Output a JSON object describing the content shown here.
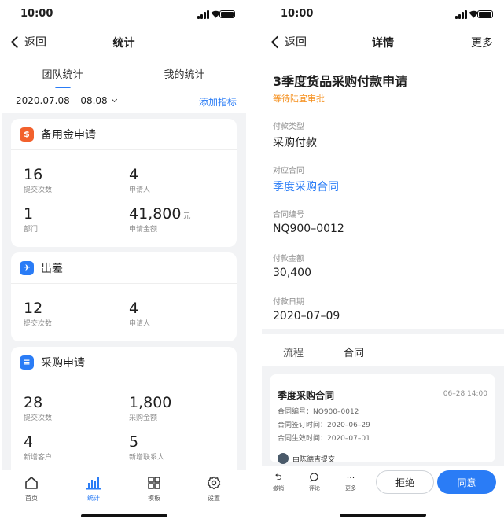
{
  "status": {
    "time": "10:00"
  },
  "left": {
    "nav": {
      "back": "返回",
      "title": "统计"
    },
    "tabs": [
      "团队统计",
      "我的统计"
    ],
    "filter": {
      "date_range": "2020.07.08 – 08.08",
      "add_metric": "添加指标"
    },
    "cards": [
      {
        "title": "备用金申请",
        "icon": "money-bag-icon",
        "color": "#f2612d",
        "stats": [
          {
            "value": "16",
            "label": "提交次数"
          },
          {
            "value": "4",
            "label": "申请人"
          },
          {
            "value": "1",
            "label": "部门"
          },
          {
            "value": "41,800",
            "unit": "元",
            "label": "申请金额"
          }
        ]
      },
      {
        "title": "出差",
        "icon": "plane-icon",
        "color": "#2a7cf6",
        "stats": [
          {
            "value": "12",
            "label": "提交次数"
          },
          {
            "value": "4",
            "label": "申请人"
          }
        ]
      },
      {
        "title": "采购申请",
        "icon": "document-icon",
        "color": "#2a7cf6",
        "stats": [
          {
            "value": "28",
            "label": "提交次数"
          },
          {
            "value": "1,800",
            "label": "采购金额"
          },
          {
            "value": "4",
            "label": "新增客户"
          },
          {
            "value": "5",
            "label": "新增联系人"
          }
        ]
      }
    ],
    "tabbar": [
      {
        "label": "首页",
        "icon": "home-icon"
      },
      {
        "label": "统计",
        "icon": "chart-icon"
      },
      {
        "label": "模板",
        "icon": "grid-icon"
      },
      {
        "label": "设置",
        "icon": "gear-icon"
      }
    ]
  },
  "right": {
    "nav": {
      "back": "返回",
      "title": "详情",
      "more": "更多"
    },
    "title": "3季度货品采购付款申请",
    "status": "等待陆宜审批",
    "fields": [
      {
        "label": "付款类型",
        "value": "采购付款"
      },
      {
        "label": "对应合同",
        "value": "季度采购合同"
      },
      {
        "label": "合同编号",
        "value": "NQ900–0012"
      },
      {
        "label": "付款金额",
        "value": "30,400"
      },
      {
        "label": "付款日期",
        "value": "2020–07–09"
      }
    ],
    "tabs": [
      "流程",
      "合同"
    ],
    "contract": {
      "title": "季度采购合同",
      "time": "06–28 14:00",
      "lines": [
        "合同编号：NQ900–0012",
        "合同签订时间：2020–06–29",
        "合同生效时间：2020–07–01"
      ],
      "submitter": "由陈德吉提交"
    },
    "actions": [
      {
        "label": "撤销",
        "icon": "undo-icon"
      },
      {
        "label": "评论",
        "icon": "comment-icon"
      },
      {
        "label": "更多",
        "icon": "more-icon"
      }
    ],
    "reject": "拒绝",
    "agree": "同意"
  },
  "colors": {
    "accent": "#2a7cf6",
    "pending": "#f5901e",
    "petty_cash": "#f2612d"
  }
}
